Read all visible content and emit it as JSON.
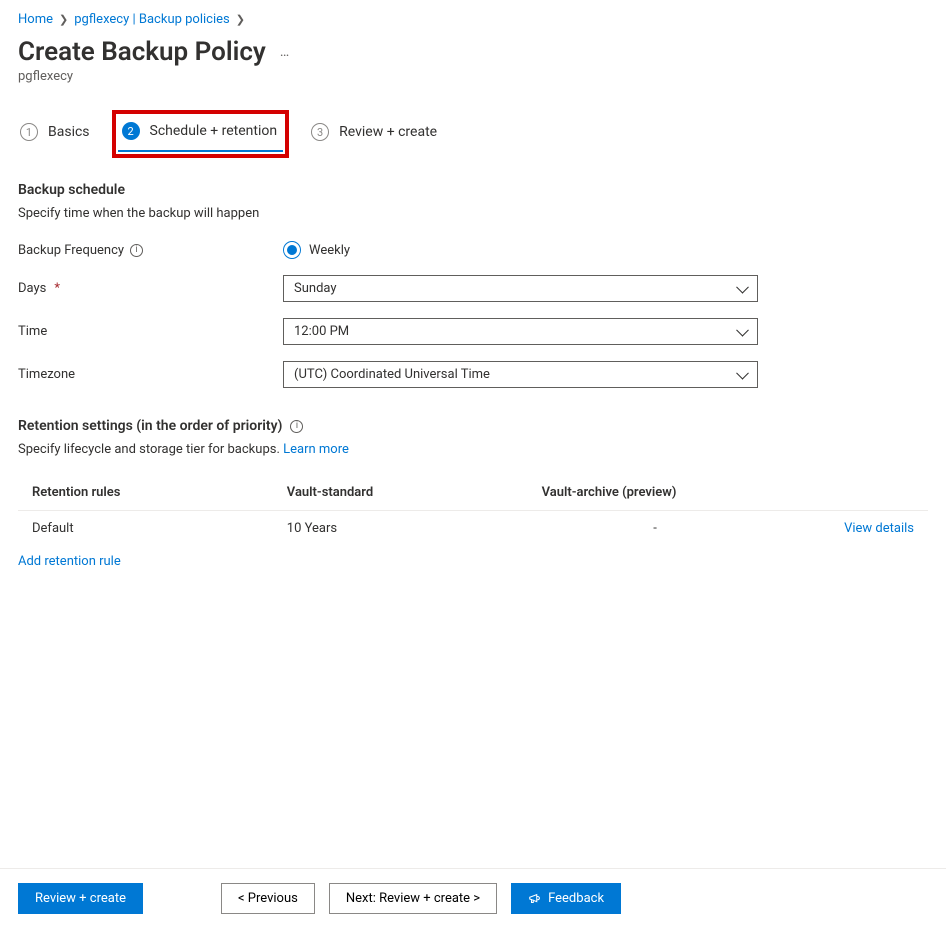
{
  "breadcrumb": {
    "items": [
      "Home",
      "pgflexecy | Backup policies"
    ]
  },
  "page": {
    "title": "Create Backup Policy",
    "subtitle": "pgflexecy"
  },
  "tabs": {
    "basics": {
      "num": "1",
      "label": "Basics"
    },
    "schedule": {
      "num": "2",
      "label": "Schedule + retention"
    },
    "review": {
      "num": "3",
      "label": "Review + create"
    }
  },
  "schedule_section": {
    "heading": "Backup schedule",
    "desc": "Specify time when the backup will happen",
    "freq_label": "Backup Frequency",
    "freq_value": "Weekly",
    "days_label": "Days",
    "days_value": "Sunday",
    "time_label": "Time",
    "time_value": "12:00 PM",
    "tz_label": "Timezone",
    "tz_value": "(UTC) Coordinated Universal Time"
  },
  "retention_section": {
    "heading": "Retention settings (in the order of priority)",
    "desc_prefix": "Specify lifecycle and storage tier for backups. ",
    "learn_more": "Learn more",
    "columns": {
      "rules": "Retention rules",
      "standard": "Vault-standard",
      "archive": "Vault-archive (preview)"
    },
    "rows": [
      {
        "name": "Default",
        "standard": "10 Years",
        "archive": "-",
        "action": "View details"
      }
    ],
    "add_rule": "Add retention rule"
  },
  "footer": {
    "review": "Review + create",
    "previous": "< Previous",
    "next": "Next: Review + create >",
    "feedback": "Feedback"
  }
}
